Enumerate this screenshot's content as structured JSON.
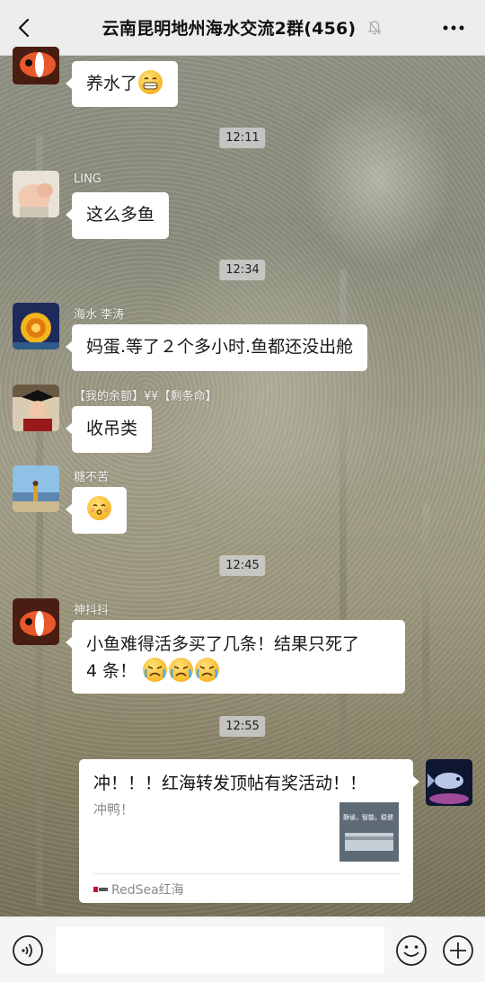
{
  "header": {
    "title": "云南昆明地州海水交流2群(456)",
    "back_icon": "chevron-left-icon",
    "mute_icon": "bell-off-icon",
    "more_icon": "more-horizontal-icon"
  },
  "messages": [
    {
      "type": "text",
      "text": "养水了",
      "emoji": [
        "grin"
      ]
    },
    {
      "type": "time",
      "text": "12:11"
    },
    {
      "type": "text",
      "sender": "LING",
      "text": "这么多鱼"
    },
    {
      "type": "time",
      "text": "12:34"
    },
    {
      "type": "text",
      "sender": "海水 李涛",
      "text": "妈蛋.等了２个多小时.鱼都还没出舱"
    },
    {
      "type": "text",
      "sender": "【我的余额】¥¥【剩条命】",
      "text": "收吊类"
    },
    {
      "type": "text",
      "sender": "糖不苦",
      "text": "",
      "emoji": [
        "kiss"
      ]
    },
    {
      "type": "time",
      "text": "12:45"
    },
    {
      "type": "text",
      "sender": "神抖抖",
      "line1": "小鱼难得活多买了几条！结果只死了",
      "line2": "4 条！",
      "emoji": [
        "cry",
        "cry",
        "cry"
      ]
    },
    {
      "type": "time",
      "text": "12:55"
    },
    {
      "type": "link_card",
      "title": "冲！！！红海转发顶帖有奖活动！！",
      "desc": "冲鸭！",
      "thumb_text": "静谧，智能，稳健",
      "source": "RedSea红海"
    }
  ],
  "input": {
    "value": "",
    "voice_icon": "voice-icon",
    "emoji_icon": "emoji-icon",
    "plus_icon": "plus-icon"
  }
}
